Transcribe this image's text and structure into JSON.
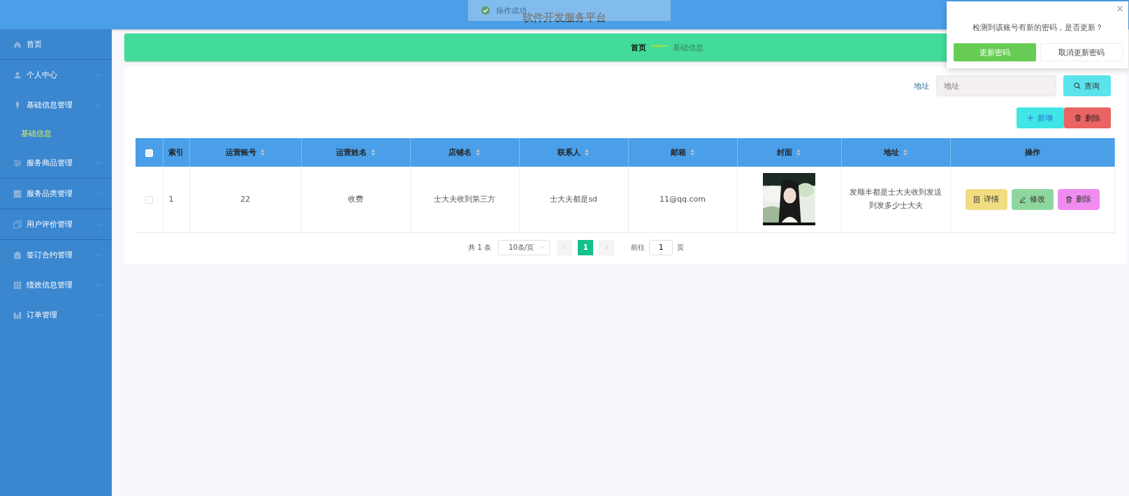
{
  "header": {
    "title": "软件开发服务平台"
  },
  "toast": {
    "message": "操作成功"
  },
  "sidebar": {
    "items": [
      {
        "label": "首页"
      },
      {
        "label": "个人中心",
        "expanded": false
      },
      {
        "label": "基础信息管理",
        "expanded": true,
        "children": [
          {
            "label": "基础信息",
            "selected": true
          }
        ]
      },
      {
        "label": "服务商品管理",
        "expanded": false
      },
      {
        "label": "服务品类管理",
        "expanded": false
      },
      {
        "label": "用户评价管理",
        "expanded": false
      },
      {
        "label": "签订合约管理",
        "expanded": false
      },
      {
        "label": "绩效信息管理",
        "expanded": false
      },
      {
        "label": "订单管理",
        "expanded": false
      }
    ]
  },
  "breadcrumb": {
    "items": [
      "首页",
      "基础信息"
    ],
    "separator": "*****"
  },
  "search": {
    "label": "地址",
    "placeholder": "地址",
    "button": "查询"
  },
  "actions": [
    {
      "label": "新增",
      "kind": "add"
    },
    {
      "label": "删除",
      "kind": "delete"
    }
  ],
  "table": {
    "columns": [
      {
        "label": "索引",
        "sortable": false
      },
      {
        "label": "运营账号",
        "sortable": true
      },
      {
        "label": "运营姓名",
        "sortable": true
      },
      {
        "label": "店铺名",
        "sortable": true
      },
      {
        "label": "联系人",
        "sortable": true
      },
      {
        "label": "邮箱",
        "sortable": true
      },
      {
        "label": "封面",
        "sortable": true
      },
      {
        "label": "地址",
        "sortable": true
      },
      {
        "label": "操作",
        "sortable": false
      }
    ],
    "header_checked": false,
    "rows": [
      {
        "checked": false,
        "index": "1",
        "account": "22",
        "name": "收费",
        "shop": "士大夫收到第三方",
        "contact": "士大夫都是sd",
        "email": "11@qq.com",
        "address": "发顺丰都是士大夫收到发送到发多少士大夫",
        "buttons": [
          {
            "label": "详情",
            "kind": "detail"
          },
          {
            "label": "修改",
            "kind": "edit"
          },
          {
            "label": "删除",
            "kind": "delete"
          }
        ]
      }
    ]
  },
  "pagination": {
    "total": "共 1 条",
    "page_size": "10条/页",
    "pages": [
      {
        "label": "1",
        "selected": true
      }
    ],
    "goto_label": "前往",
    "goto_value": "1",
    "goto_suffix": "页"
  },
  "popup": {
    "message": "检测到该账号有新的密码，是否更新？",
    "close": "×",
    "buttons": [
      {
        "label": "更新密码",
        "kind": "primary"
      },
      {
        "label": "取消更新密码",
        "kind": "plain"
      }
    ]
  }
}
